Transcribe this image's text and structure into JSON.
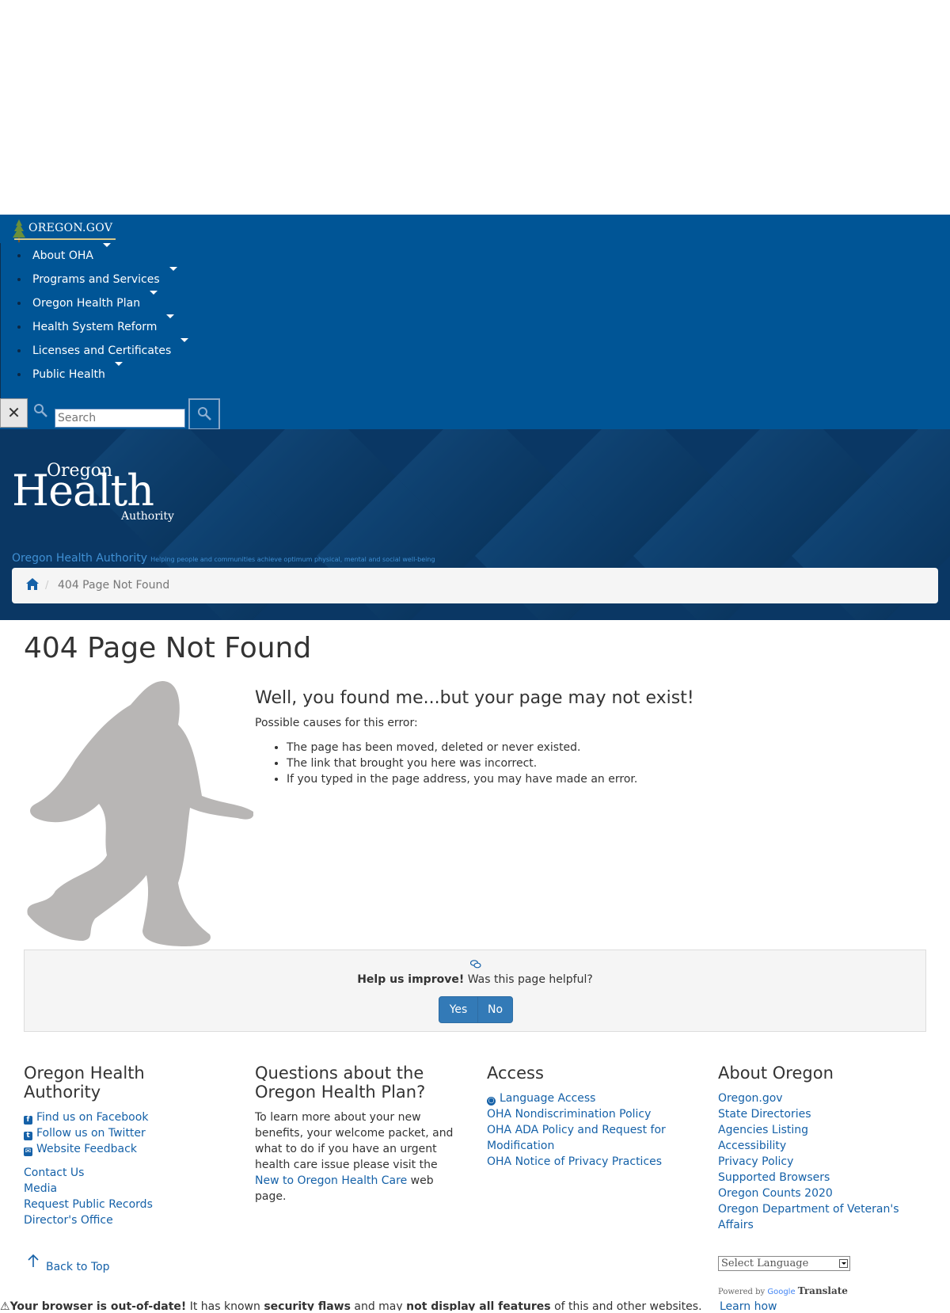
{
  "top_nav": {
    "logo_text": "OREGON.GOV",
    "items": [
      {
        "label": "About OHA"
      },
      {
        "label": "Programs and Services"
      },
      {
        "label": "Oregon Health Plan"
      },
      {
        "label": "Health System Reform"
      },
      {
        "label": "Licenses and Certificates"
      },
      {
        "label": "Public Health"
      }
    ],
    "search": {
      "placeholder": "Search",
      "close_symbol": "✕"
    }
  },
  "banner": {
    "logo": {
      "oregon": "Oregon",
      "health": "Health",
      "authority": "Authority"
    },
    "site_name": "Oregon Health Authority",
    "tagline": "Helping people and communities achieve optimum physical, mental and social well-being",
    "breadcrumb": {
      "current": "404 Page Not Found"
    }
  },
  "main": {
    "title": "404 Page Not Found",
    "heading": "Well, you found me...but your page may not exist!",
    "intro": "Possible causes for this error:",
    "causes": [
      "The page has been moved, deleted or never existed.",
      "The link that brought you here was incorrect.",
      "If you typed in the page address, you may have made an error."
    ]
  },
  "feedback": {
    "bold": "Help us improve!",
    "question": " Was this page helpful?",
    "yes": "Yes",
    "no": "No"
  },
  "footer": {
    "col1": {
      "title": "Oregon Health Authority",
      "social": [
        "Find us on Facebook",
        "Follow us on Twitter",
        "Website Feedback"
      ],
      "links": [
        "Contact Us",
        "Media",
        "Request Public Records",
        "Director's Office"
      ]
    },
    "col2": {
      "title": "Questions about the Oregon Health Plan?",
      "text_before": "To learn more about your new benefits, your welcome packet, and what to do if you have an urgent health care issue please visit the ",
      "link": "New to Oregon Health Care",
      "text_after": " web page."
    },
    "col3": {
      "title": "Access",
      "links": [
        "Language Access",
        "OHA Nondiscrimination Policy",
        "OHA ADA Policy and Request for Modification",
        "OHA Notice of Privacy Practices"
      ]
    },
    "col4": {
      "title": "About Oregon",
      "links": [
        "Oregon.gov",
        "State Directories",
        "Agencies Listing",
        "Accessibility",
        "Privacy Policy",
        "Supported Browsers",
        "Oregon Counts 2020",
        "Oregon Department of Veteran's Affairs"
      ]
    },
    "back_to_top": "Back to Top",
    "language_select": "Select Language",
    "powered_by": "Powered by",
    "google": "Google",
    "translate": "Translate"
  },
  "outdated_notice": {
    "part1": "Your browser is out-of-date!",
    "part2": " It has known ",
    "part3": "security flaws",
    "part4": " and may ",
    "part5": "not display all features",
    "part6": " of this and other websites.",
    "learn_how": "Learn how"
  },
  "colors": {
    "nav_bg": "#005596",
    "banner_bg": "#0b3a66",
    "link": "#1561a8",
    "button": "#337ab7"
  }
}
